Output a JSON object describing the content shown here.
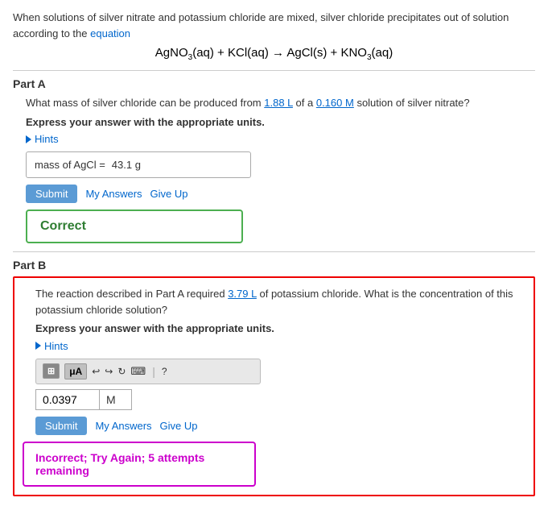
{
  "intro": {
    "text": "When solutions of silver nitrate and potassium chloride are mixed, silver chloride precipitates out of solution according to the equation"
  },
  "equation": {
    "display": "AgNO₃(aq) + KCl(aq) → AgCl(s) + KNO₃(aq)"
  },
  "partA": {
    "label": "Part A",
    "question": "What mass of silver chloride can be produced from 1.88 L of a 0.160 M solution of silver nitrate?",
    "underline1": "1.88 L",
    "underline2": "0.160 M",
    "express": "Express your answer with the appropriate units.",
    "hints_label": "Hints",
    "answer_label": "mass of AgCl =",
    "answer_value": "43.1 g",
    "submit_label": "Submit",
    "my_answers_label": "My Answers",
    "give_up_label": "Give Up",
    "correct_label": "Correct"
  },
  "partB": {
    "label": "Part B",
    "question": "The reaction described in Part A required 3.79 L of potassium chloride. What is the concentration of this potassium chloride solution?",
    "underline1": "3.79 L",
    "express": "Express your answer with the appropriate units.",
    "hints_label": "Hints",
    "input_value": "0.0397",
    "input_unit": "M",
    "submit_label": "Submit",
    "my_answers_label": "My Answers",
    "give_up_label": "Give Up",
    "incorrect_label": "Incorrect; Try Again; 5 attempts remaining",
    "toolbar": {
      "undo_icon": "↩",
      "redo_icon": "↪",
      "refresh_icon": "↻",
      "keyboard_icon": "⌨",
      "help_icon": "?"
    }
  },
  "colors": {
    "blue": "#0066cc",
    "green": "#4caf50",
    "red": "#cc0000",
    "purple": "#cc00cc",
    "submit_bg": "#5b9bd5"
  }
}
